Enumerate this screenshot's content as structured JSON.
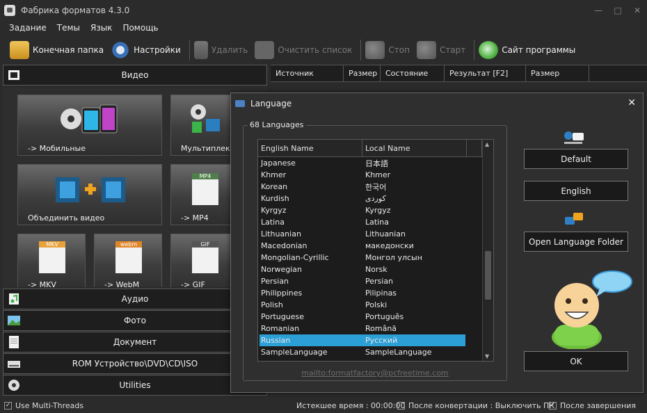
{
  "window": {
    "title": "Фабрика форматов 4.3.0"
  },
  "menu": [
    "Задание",
    "Темы",
    "Язык",
    "Помощь"
  ],
  "toolbar": {
    "output_folder": "Конечная папка",
    "settings": "Настройки",
    "remove": "Удалить",
    "clear_list": "Очистить список",
    "stop": "Стоп",
    "start": "Старт",
    "website": "Сайт программы"
  },
  "categories": {
    "video": "Видео",
    "audio": "Аудио",
    "photo": "Фото",
    "document": "Документ",
    "rom": "ROM Устройство\\DVD\\CD\\ISO",
    "utilities": "Utilities"
  },
  "tiles": {
    "mobile": "-> Мобильные",
    "muxer": "Мультиплексор",
    "join": "Объединить видео",
    "mp4": "-> MP4",
    "mkv": "-> MKV",
    "webm": "-> WebM",
    "gif": "-> GIF",
    "mp4_badge": "MP4",
    "mkv_badge": "MKV",
    "webm_badge": "webm",
    "gif_badge": "GIF"
  },
  "table_headers": [
    "Источник",
    "Размер",
    "Состояние",
    "Результат [F2]",
    "Размер"
  ],
  "status": {
    "multithreads": "Use Multi-Threads",
    "elapsed": "Истекшее время : 00:00:00",
    "after_convert": "После конвертации : Выключить ПК",
    "after_finish": "После завершения"
  },
  "dialog": {
    "title": "Language",
    "group_label": "68 Languages",
    "col_english": "English Name",
    "col_local": "Local Name",
    "languages": [
      [
        "Japanese",
        "日本語"
      ],
      [
        "Khmer",
        "Khmer"
      ],
      [
        "Korean",
        "한국어"
      ],
      [
        "Kurdish",
        "کوردی"
      ],
      [
        "Kyrgyz",
        "Kyrgyz"
      ],
      [
        "Latina",
        "Latina"
      ],
      [
        "Lithuanian",
        "Lithuanian"
      ],
      [
        "Macedonian",
        "македонски"
      ],
      [
        "Mongolian-Cyrillic",
        "Монгол улсын"
      ],
      [
        "Norwegian",
        "Norsk"
      ],
      [
        "Persian",
        "Persian"
      ],
      [
        "Philippines",
        "Pilipinas"
      ],
      [
        "Polish",
        "Polski"
      ],
      [
        "Portuguese",
        "Português"
      ],
      [
        "Romanian",
        "Română"
      ],
      [
        "Russian",
        "Русский"
      ],
      [
        "SampleLanguage",
        "SampleLanguage"
      ]
    ],
    "selected": "Russian",
    "email": "mailto:formatfactory@pcfreetime.com",
    "btn_default": "Default",
    "btn_english": "English",
    "btn_open_folder": "Open Language Folder",
    "btn_ok": "OK"
  },
  "colors": {
    "selection": "#2b9fd6",
    "background": "#2b2b2b"
  }
}
